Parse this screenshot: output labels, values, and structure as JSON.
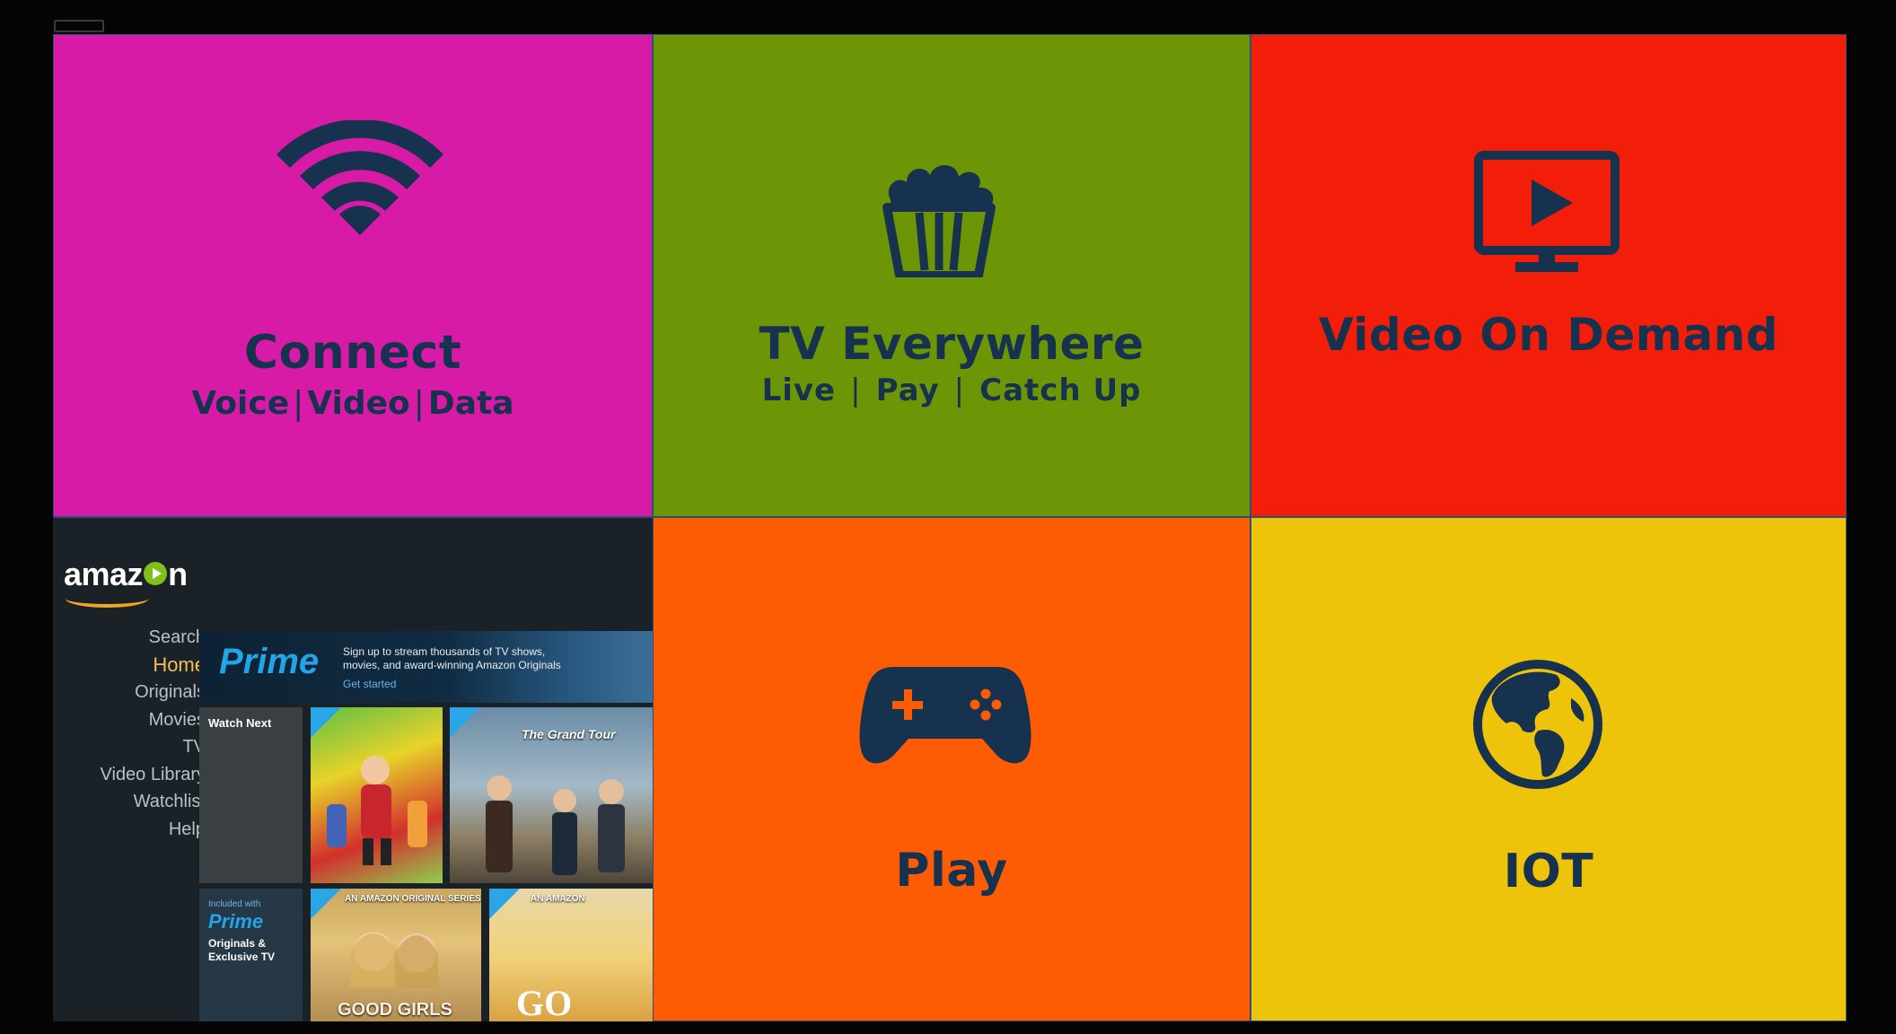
{
  "tiles": {
    "connect": {
      "title": "Connect",
      "subtitle": [
        "Voice",
        "Video",
        "Data"
      ],
      "icon": "wifi-icon",
      "color": "#d81ba7"
    },
    "tv_everywhere": {
      "title": "TV Everywhere",
      "subtitle": [
        "Live",
        "Pay",
        "Catch Up"
      ],
      "icon": "popcorn-icon",
      "color": "#6c9605"
    },
    "vod": {
      "title": "Video On Demand",
      "icon": "monitor-play-icon",
      "color": "#f31e0a"
    },
    "play": {
      "title": "Play",
      "icon": "gamepad-icon",
      "color": "#fe5c04"
    },
    "iot": {
      "title": "IOT",
      "icon": "globe-icon",
      "color": "#edc40a"
    }
  },
  "amazon": {
    "logo": "amazon",
    "nav": [
      "Search",
      "Home",
      "Originals",
      "Movies",
      "TV",
      "Video Library",
      "Watchlist",
      "Help"
    ],
    "active_nav": "Home",
    "banner": {
      "brand": "Prime",
      "text": "Sign up to stream thousands of TV shows, movies, and award-winning Amazon Originals",
      "cta": "Get started"
    },
    "watch_next": "Watch Next",
    "posters": [
      "The Grand Tour",
      "GOOD GIRLS",
      "AN AMAZON ORIGINAL SERIES",
      "AN AMAZON"
    ],
    "prime_card": {
      "small": "Included with",
      "brand": "Prime",
      "text": "Originals & Exclusive TV"
    }
  },
  "colors": {
    "text_navy": "#17324f",
    "tile_border": "#2b4f7a"
  }
}
